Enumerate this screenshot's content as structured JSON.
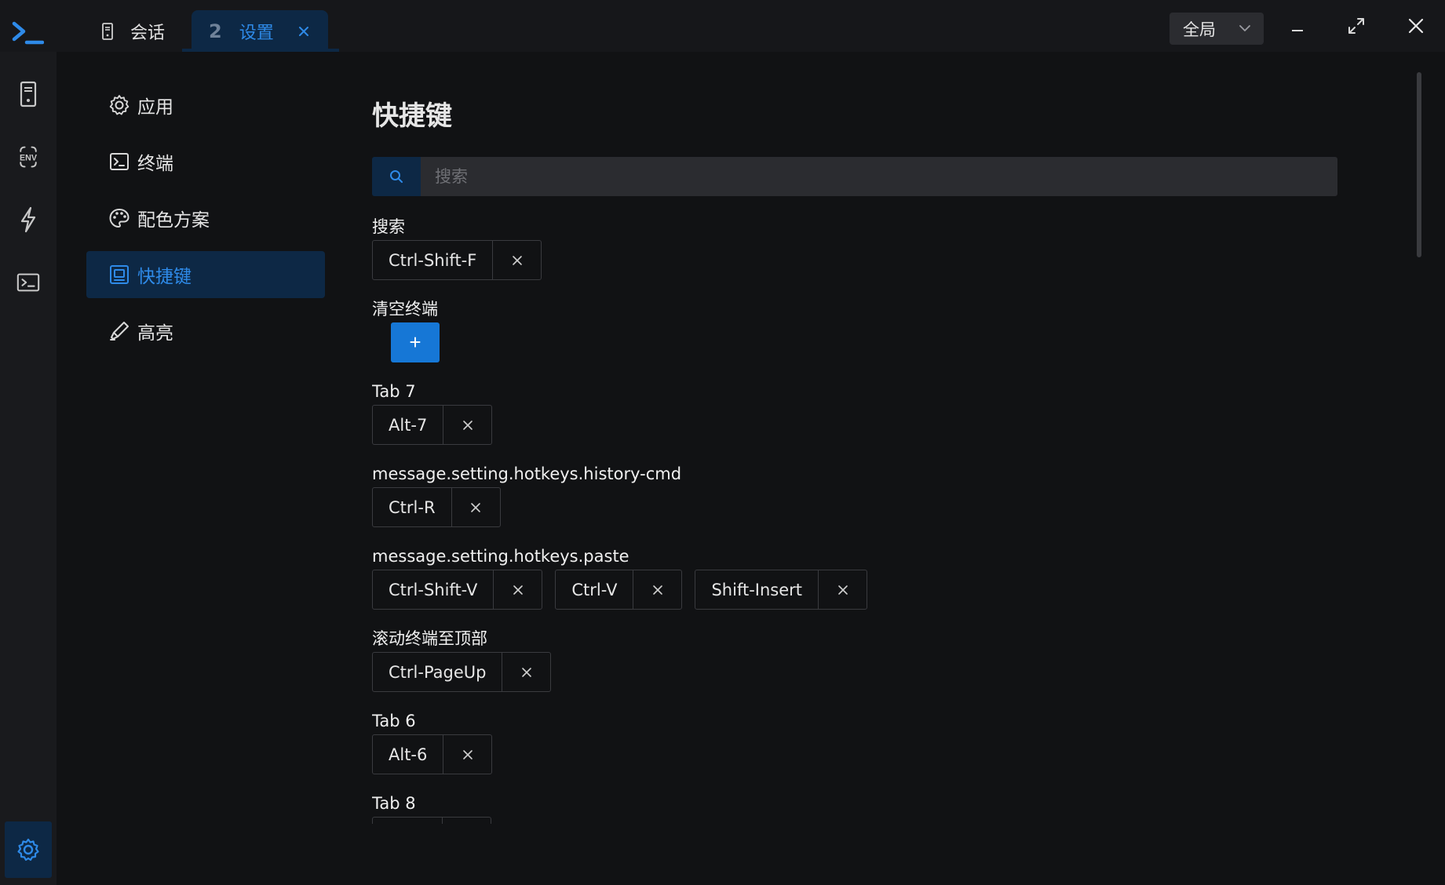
{
  "titlebar": {
    "tabs": [
      {
        "label": "会话",
        "icon": "server-icon"
      },
      {
        "index": "2",
        "label": "设置",
        "icon": "close-icon"
      }
    ],
    "scope_select": {
      "value": "全局"
    },
    "window_controls": [
      "minimize-icon",
      "maximize-icon",
      "close-icon"
    ]
  },
  "rail": {
    "items": [
      "server-icon",
      "env-icon",
      "lightning-icon",
      "terminal-icon"
    ],
    "bottom": "gear-icon"
  },
  "nav": {
    "items": [
      {
        "label": "应用",
        "icon": "gear-icon"
      },
      {
        "label": "终端",
        "icon": "terminal-icon"
      },
      {
        "label": "配色方案",
        "icon": "palette-icon"
      },
      {
        "label": "快捷键",
        "icon": "keyboard-icon",
        "active": true
      },
      {
        "label": "高亮",
        "icon": "highlighter-icon"
      }
    ]
  },
  "main": {
    "title": "快捷键",
    "search": {
      "placeholder": "搜索",
      "value": ""
    },
    "hotkeys": [
      {
        "label": "搜索",
        "keys": [
          "Ctrl-Shift-F"
        ]
      },
      {
        "label": "清空终端",
        "keys": [],
        "add_label": "+"
      },
      {
        "label": "Tab 7",
        "keys": [
          "Alt-7"
        ]
      },
      {
        "label": "message.setting.hotkeys.history-cmd",
        "keys": [
          "Ctrl-R"
        ]
      },
      {
        "label": "message.setting.hotkeys.paste",
        "keys": [
          "Ctrl-Shift-V",
          "Ctrl-V",
          "Shift-Insert"
        ]
      },
      {
        "label": "滚动终端至顶部",
        "keys": [
          "Ctrl-PageUp"
        ]
      },
      {
        "label": "Tab 6",
        "keys": [
          "Alt-6"
        ]
      },
      {
        "label": "Tab 8",
        "keys": [
          ""
        ]
      }
    ]
  },
  "colors": {
    "accent": "#2e8ae8",
    "active_bg": "#0d2845",
    "primary_button": "#1677d6",
    "background": "#111214"
  }
}
